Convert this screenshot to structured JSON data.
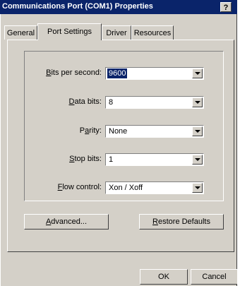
{
  "window": {
    "title": "Communications Port (COM1) Properties",
    "help_label": "?"
  },
  "tabs": [
    {
      "label": "General",
      "active": false
    },
    {
      "label": "Port Settings",
      "active": true
    },
    {
      "label": "Driver",
      "active": false
    },
    {
      "label": "Resources",
      "active": false
    }
  ],
  "settings": {
    "bits_per_second": {
      "mnemonic": "B",
      "rest": "its per second:",
      "value": "9600"
    },
    "data_bits": {
      "mnemonic": "D",
      "rest": "ata bits:",
      "value": "8"
    },
    "parity": {
      "pre": "P",
      "mnemonic": "a",
      "rest": "rity:",
      "value": "None"
    },
    "stop_bits": {
      "mnemonic": "S",
      "rest": "top bits:",
      "value": "1"
    },
    "flow_control": {
      "mnemonic": "F",
      "rest": "low control:",
      "value": "Xon / Xoff"
    }
  },
  "buttons": {
    "advanced": {
      "mnemonic": "A",
      "rest": "dvanced..."
    },
    "restore": {
      "mnemonic": "R",
      "rest": "estore Defaults"
    },
    "ok": "OK",
    "cancel": "Cancel"
  }
}
